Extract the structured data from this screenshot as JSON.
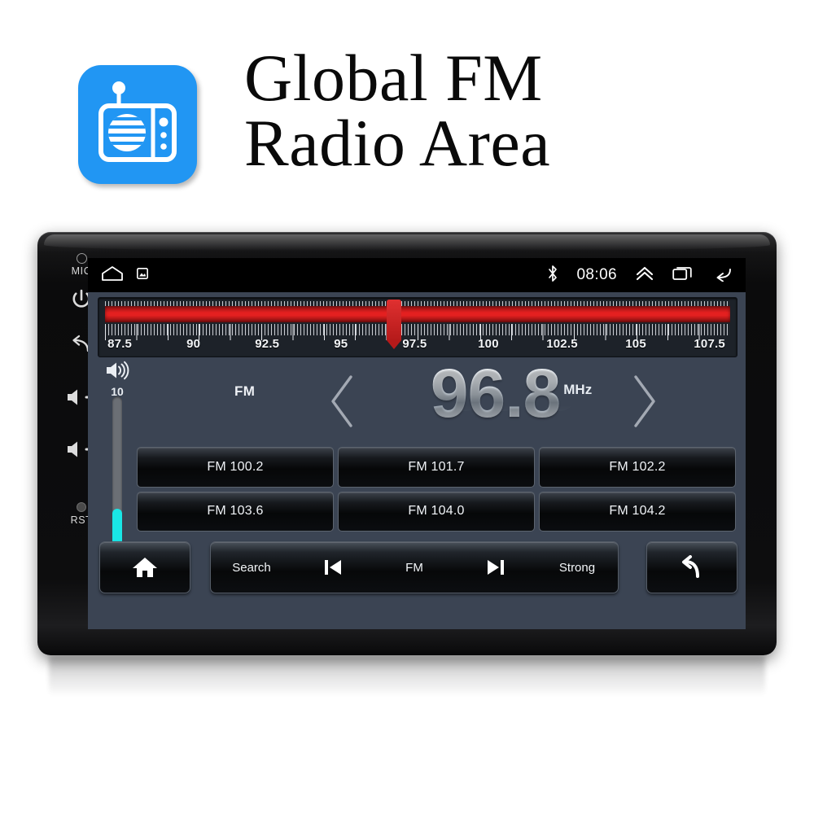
{
  "header": {
    "title_line1": "Global FM",
    "title_line2": "Radio Area",
    "icon_name": "radio-icon",
    "icon_bg": "#2196f3"
  },
  "device": {
    "bezel_buttons": [
      {
        "name": "mic",
        "label": "MIC"
      },
      {
        "name": "power",
        "label": ""
      },
      {
        "name": "back",
        "label": ""
      },
      {
        "name": "volume-up",
        "label": ""
      },
      {
        "name": "volume-down",
        "label": ""
      },
      {
        "name": "reset",
        "label": "RST"
      }
    ]
  },
  "statusbar": {
    "home_icon": "home-icon",
    "screenshot_icon": "screenshot-icon",
    "bluetooth_icon": "bluetooth-icon",
    "clock": "08:06",
    "expand_icon": "chevron-up-icon",
    "recents_icon": "recents-icon",
    "back_icon": "back-icon"
  },
  "radio": {
    "band": "FM",
    "frequency": "96.8",
    "unit": "MHz",
    "prev_icon": "chevron-left-icon",
    "next_icon": "chevron-right-icon",
    "volume": {
      "icon": "speaker-icon",
      "level_label": "10",
      "fill_percent": 31,
      "fill_color": "#19e6e6"
    },
    "dial": {
      "min": 87.0,
      "max": 108.2,
      "pointer_value": 96.8,
      "band_color": "#e42020",
      "ticks": [
        "87.5",
        "90",
        "92.5",
        "95",
        "97.5",
        "100",
        "102.5",
        "105",
        "107.5"
      ],
      "tick_values": [
        87.5,
        90,
        92.5,
        95,
        97.5,
        100,
        102.5,
        105,
        107.5
      ]
    },
    "presets": [
      {
        "label": "FM 100.2"
      },
      {
        "label": "FM 101.7"
      },
      {
        "label": "FM 102.2"
      },
      {
        "label": "FM 103.6"
      },
      {
        "label": "FM 104.0"
      },
      {
        "label": "FM 104.2"
      }
    ],
    "bottombar": {
      "home_icon": "home-icon",
      "search_label": "Search",
      "prev_icon": "skip-previous-icon",
      "band_label": "FM",
      "next_icon": "skip-next-icon",
      "strong_label": "Strong",
      "back_icon": "back-arrow-icon"
    }
  }
}
